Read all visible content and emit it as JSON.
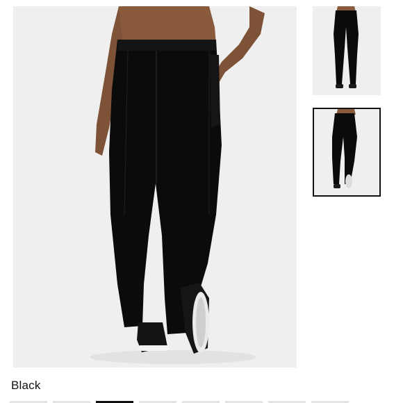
{
  "product": {
    "selected_color": "Black"
  },
  "gallery": {
    "main_image": "leggings-back-view",
    "thumbnails": [
      "leggings-front-view",
      "leggings-back-view"
    ],
    "selected_thumbnail_index": 1
  },
  "swatches": {
    "count": 8,
    "selected_index": 2,
    "selected_color": "#111111",
    "unselected_color": "#e4e4e4"
  }
}
